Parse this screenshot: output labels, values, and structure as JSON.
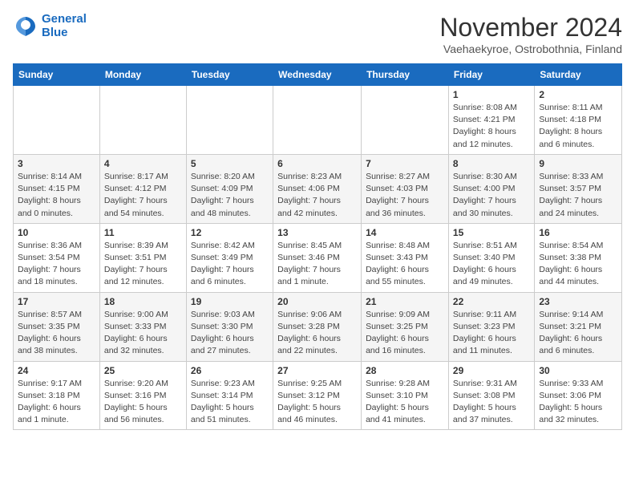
{
  "header": {
    "logo_line1": "General",
    "logo_line2": "Blue",
    "title": "November 2024",
    "subtitle": "Vaehaekyroe, Ostrobothnia, Finland"
  },
  "weekdays": [
    "Sunday",
    "Monday",
    "Tuesday",
    "Wednesday",
    "Thursday",
    "Friday",
    "Saturday"
  ],
  "weeks": [
    [
      {
        "day": "",
        "info": ""
      },
      {
        "day": "",
        "info": ""
      },
      {
        "day": "",
        "info": ""
      },
      {
        "day": "",
        "info": ""
      },
      {
        "day": "",
        "info": ""
      },
      {
        "day": "1",
        "info": "Sunrise: 8:08 AM\nSunset: 4:21 PM\nDaylight: 8 hours and 12 minutes."
      },
      {
        "day": "2",
        "info": "Sunrise: 8:11 AM\nSunset: 4:18 PM\nDaylight: 8 hours and 6 minutes."
      }
    ],
    [
      {
        "day": "3",
        "info": "Sunrise: 8:14 AM\nSunset: 4:15 PM\nDaylight: 8 hours and 0 minutes."
      },
      {
        "day": "4",
        "info": "Sunrise: 8:17 AM\nSunset: 4:12 PM\nDaylight: 7 hours and 54 minutes."
      },
      {
        "day": "5",
        "info": "Sunrise: 8:20 AM\nSunset: 4:09 PM\nDaylight: 7 hours and 48 minutes."
      },
      {
        "day": "6",
        "info": "Sunrise: 8:23 AM\nSunset: 4:06 PM\nDaylight: 7 hours and 42 minutes."
      },
      {
        "day": "7",
        "info": "Sunrise: 8:27 AM\nSunset: 4:03 PM\nDaylight: 7 hours and 36 minutes."
      },
      {
        "day": "8",
        "info": "Sunrise: 8:30 AM\nSunset: 4:00 PM\nDaylight: 7 hours and 30 minutes."
      },
      {
        "day": "9",
        "info": "Sunrise: 8:33 AM\nSunset: 3:57 PM\nDaylight: 7 hours and 24 minutes."
      }
    ],
    [
      {
        "day": "10",
        "info": "Sunrise: 8:36 AM\nSunset: 3:54 PM\nDaylight: 7 hours and 18 minutes."
      },
      {
        "day": "11",
        "info": "Sunrise: 8:39 AM\nSunset: 3:51 PM\nDaylight: 7 hours and 12 minutes."
      },
      {
        "day": "12",
        "info": "Sunrise: 8:42 AM\nSunset: 3:49 PM\nDaylight: 7 hours and 6 minutes."
      },
      {
        "day": "13",
        "info": "Sunrise: 8:45 AM\nSunset: 3:46 PM\nDaylight: 7 hours and 1 minute."
      },
      {
        "day": "14",
        "info": "Sunrise: 8:48 AM\nSunset: 3:43 PM\nDaylight: 6 hours and 55 minutes."
      },
      {
        "day": "15",
        "info": "Sunrise: 8:51 AM\nSunset: 3:40 PM\nDaylight: 6 hours and 49 minutes."
      },
      {
        "day": "16",
        "info": "Sunrise: 8:54 AM\nSunset: 3:38 PM\nDaylight: 6 hours and 44 minutes."
      }
    ],
    [
      {
        "day": "17",
        "info": "Sunrise: 8:57 AM\nSunset: 3:35 PM\nDaylight: 6 hours and 38 minutes."
      },
      {
        "day": "18",
        "info": "Sunrise: 9:00 AM\nSunset: 3:33 PM\nDaylight: 6 hours and 32 minutes."
      },
      {
        "day": "19",
        "info": "Sunrise: 9:03 AM\nSunset: 3:30 PM\nDaylight: 6 hours and 27 minutes."
      },
      {
        "day": "20",
        "info": "Sunrise: 9:06 AM\nSunset: 3:28 PM\nDaylight: 6 hours and 22 minutes."
      },
      {
        "day": "21",
        "info": "Sunrise: 9:09 AM\nSunset: 3:25 PM\nDaylight: 6 hours and 16 minutes."
      },
      {
        "day": "22",
        "info": "Sunrise: 9:11 AM\nSunset: 3:23 PM\nDaylight: 6 hours and 11 minutes."
      },
      {
        "day": "23",
        "info": "Sunrise: 9:14 AM\nSunset: 3:21 PM\nDaylight: 6 hours and 6 minutes."
      }
    ],
    [
      {
        "day": "24",
        "info": "Sunrise: 9:17 AM\nSunset: 3:18 PM\nDaylight: 6 hours and 1 minute."
      },
      {
        "day": "25",
        "info": "Sunrise: 9:20 AM\nSunset: 3:16 PM\nDaylight: 5 hours and 56 minutes."
      },
      {
        "day": "26",
        "info": "Sunrise: 9:23 AM\nSunset: 3:14 PM\nDaylight: 5 hours and 51 minutes."
      },
      {
        "day": "27",
        "info": "Sunrise: 9:25 AM\nSunset: 3:12 PM\nDaylight: 5 hours and 46 minutes."
      },
      {
        "day": "28",
        "info": "Sunrise: 9:28 AM\nSunset: 3:10 PM\nDaylight: 5 hours and 41 minutes."
      },
      {
        "day": "29",
        "info": "Sunrise: 9:31 AM\nSunset: 3:08 PM\nDaylight: 5 hours and 37 minutes."
      },
      {
        "day": "30",
        "info": "Sunrise: 9:33 AM\nSunset: 3:06 PM\nDaylight: 5 hours and 32 minutes."
      }
    ]
  ]
}
